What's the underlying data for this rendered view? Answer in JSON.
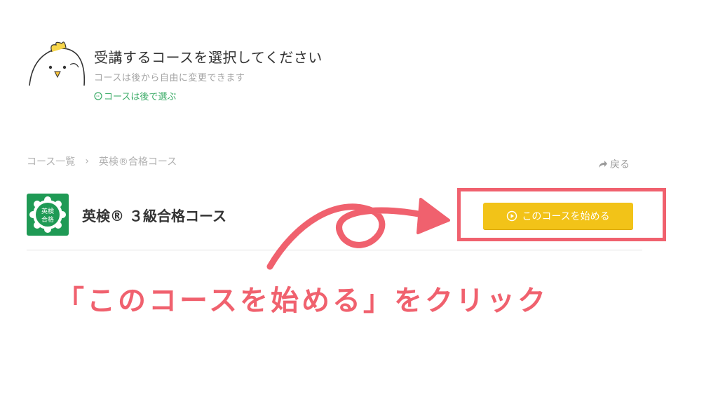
{
  "header": {
    "title": "受講するコースを選択してください",
    "subtitle": "コースは後から自由に変更できます",
    "later_link": "コースは後で選ぶ"
  },
  "breadcrumb": {
    "items": [
      "コース一覧",
      "英検®合格コース"
    ],
    "separator": "›"
  },
  "back_link": "戻る",
  "course": {
    "name": "英検® ３級合格コース",
    "badge_text": [
      "英検",
      "合格"
    ]
  },
  "start_button": "このコースを始める",
  "annotation": {
    "instruction": "「このコースを始める」をクリック"
  },
  "colors": {
    "accent_red": "#f0616e",
    "button_yellow": "#f2c318",
    "badge_green": "#1f9a55",
    "link_green": "#3bab67"
  }
}
